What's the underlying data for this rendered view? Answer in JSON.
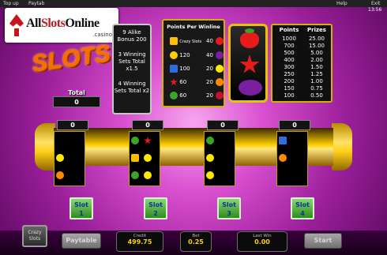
{
  "top_bar": {
    "items": [
      "Top up",
      "Paytab",
      "Help",
      "Exit"
    ],
    "time": "13:56"
  },
  "logo": {
    "name_prefix": "All",
    "name_accent": "Slots",
    "name_suffix": "Online",
    "sub": ".casino"
  },
  "brand": {
    "text": "SLOTS"
  },
  "total": {
    "label": "Total",
    "value": "0"
  },
  "bonus": {
    "line1": "9 Alike Bonus 200",
    "line2": "3 Winning Sets Total x1.5",
    "line3": "4 Winning Sets Total x2"
  },
  "ppw": {
    "title": "Points Per Winline",
    "rows": [
      {
        "left_sym": "slots",
        "left_text": "Crazy Slots",
        "right_val": "40",
        "right_sym": "strawberry"
      },
      {
        "left_val": "120",
        "right_val": "40",
        "right_sym": "plum"
      },
      {
        "left_val": "100",
        "right_val": "20",
        "right_sym": "lemon"
      },
      {
        "left_val": "60",
        "right_val": "20",
        "right_sym": "orange"
      },
      {
        "left_val": "60",
        "right_val": "20",
        "right_sym": "cherry"
      }
    ],
    "left_syms": [
      "slots",
      "bell",
      "seven",
      "star",
      "melon"
    ]
  },
  "prizes": {
    "headers": [
      "Points",
      "Prizes"
    ],
    "rows": [
      [
        "1000",
        "25.00"
      ],
      [
        "700",
        "15.00"
      ],
      [
        "500",
        "5.00"
      ],
      [
        "400",
        "2.00"
      ],
      [
        "300",
        "1.50"
      ],
      [
        "250",
        "1.25"
      ],
      [
        "200",
        "1.00"
      ],
      [
        "150",
        "0.75"
      ],
      [
        "100",
        "0.50"
      ]
    ]
  },
  "reels": {
    "counts": [
      "0",
      "0",
      "0",
      "0"
    ]
  },
  "slot_buttons": [
    {
      "label": "Slot",
      "num": "1"
    },
    {
      "label": "Slot",
      "num": "2"
    },
    {
      "label": "Slot",
      "num": "3"
    },
    {
      "label": "Slot",
      "num": "4"
    }
  ],
  "bottom": {
    "crazy": "Crazy Slots",
    "paytable": "Paytable",
    "credit_label": "Credit",
    "credit": "499.75",
    "bet_label": "Bet",
    "bet": "0.25",
    "lastwin_label": "Last Win",
    "lastwin": "0.00",
    "start": "Start"
  },
  "colors": {
    "gold": "#ffd000",
    "panel": "#181818",
    "green_btn": "#2e8c1e",
    "bg_magenta": "#d94fd0"
  }
}
